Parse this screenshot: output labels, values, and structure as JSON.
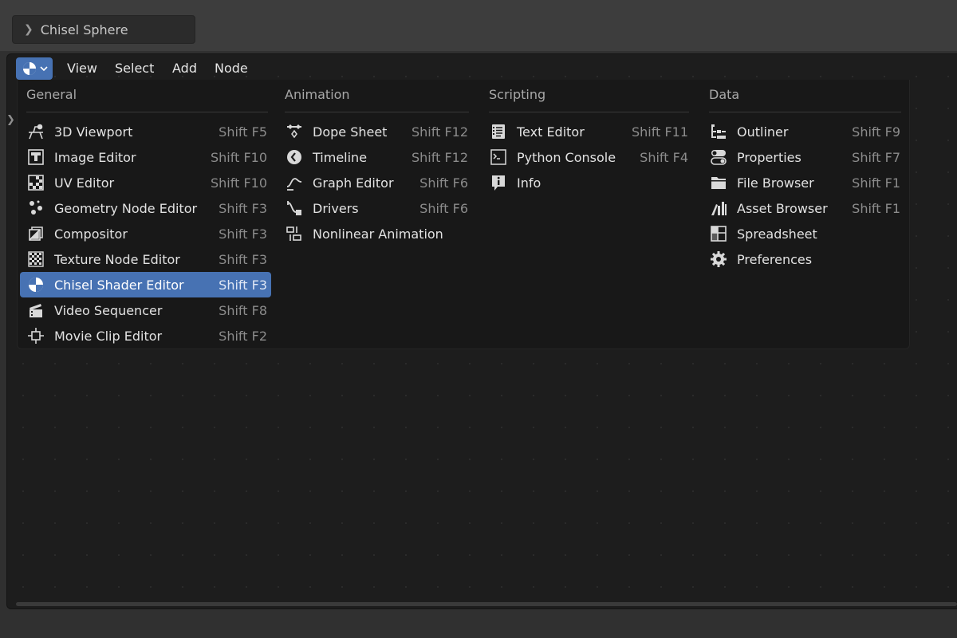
{
  "top_panel": {
    "label": "Chisel Sphere"
  },
  "header": {
    "editor_type_icon": "shader-editor-icon",
    "menus": [
      "View",
      "Select",
      "Add",
      "Node"
    ]
  },
  "popup": {
    "columns": [
      {
        "title": "General",
        "items": [
          {
            "label": "3D Viewport",
            "shortcut": "Shift F5",
            "icon": "viewport-3d-icon"
          },
          {
            "label": "Image Editor",
            "shortcut": "Shift F10",
            "icon": "image-editor-icon"
          },
          {
            "label": "UV Editor",
            "shortcut": "Shift F10",
            "icon": "uv-editor-icon"
          },
          {
            "label": "Geometry Node Editor",
            "shortcut": "Shift F3",
            "icon": "geometry-nodes-icon"
          },
          {
            "label": "Compositor",
            "shortcut": "Shift F3",
            "icon": "compositor-icon"
          },
          {
            "label": "Texture Node Editor",
            "shortcut": "Shift F3",
            "icon": "texture-node-icon"
          },
          {
            "label": "Chisel Shader Editor",
            "shortcut": "Shift F3",
            "icon": "shader-editor-icon",
            "highlighted": true
          },
          {
            "label": "Video Sequencer",
            "shortcut": "Shift F8",
            "icon": "video-sequencer-icon"
          },
          {
            "label": "Movie Clip Editor",
            "shortcut": "Shift F2",
            "icon": "movie-clip-icon"
          }
        ]
      },
      {
        "title": "Animation",
        "items": [
          {
            "label": "Dope Sheet",
            "shortcut": "Shift F12",
            "icon": "dope-sheet-icon"
          },
          {
            "label": "Timeline",
            "shortcut": "Shift F12",
            "icon": "timeline-icon"
          },
          {
            "label": "Graph Editor",
            "shortcut": "Shift F6",
            "icon": "graph-editor-icon"
          },
          {
            "label": "Drivers",
            "shortcut": "Shift F6",
            "icon": "drivers-icon"
          },
          {
            "label": "Nonlinear Animation",
            "shortcut": "",
            "icon": "nla-icon"
          }
        ]
      },
      {
        "title": "Scripting",
        "items": [
          {
            "label": "Text Editor",
            "shortcut": "Shift F11",
            "icon": "text-editor-icon"
          },
          {
            "label": "Python Console",
            "shortcut": "Shift F4",
            "icon": "python-console-icon"
          },
          {
            "label": "Info",
            "shortcut": "",
            "icon": "info-icon"
          }
        ]
      },
      {
        "title": "Data",
        "items": [
          {
            "label": "Outliner",
            "shortcut": "Shift F9",
            "icon": "outliner-icon"
          },
          {
            "label": "Properties",
            "shortcut": "Shift F7",
            "icon": "properties-icon"
          },
          {
            "label": "File Browser",
            "shortcut": "Shift F1",
            "icon": "file-browser-icon"
          },
          {
            "label": "Asset Browser",
            "shortcut": "Shift F1",
            "icon": "asset-browser-icon"
          },
          {
            "label": "Spreadsheet",
            "shortcut": "",
            "icon": "spreadsheet-icon"
          },
          {
            "label": "Preferences",
            "shortcut": "",
            "icon": "preferences-icon"
          }
        ]
      }
    ]
  },
  "colors": {
    "accent": "#4772b3",
    "popup_bg": "#181818",
    "editor_bg": "#1d1d1d",
    "text": "#e2e2e2",
    "shortcut_text": "#8c8c8c"
  }
}
